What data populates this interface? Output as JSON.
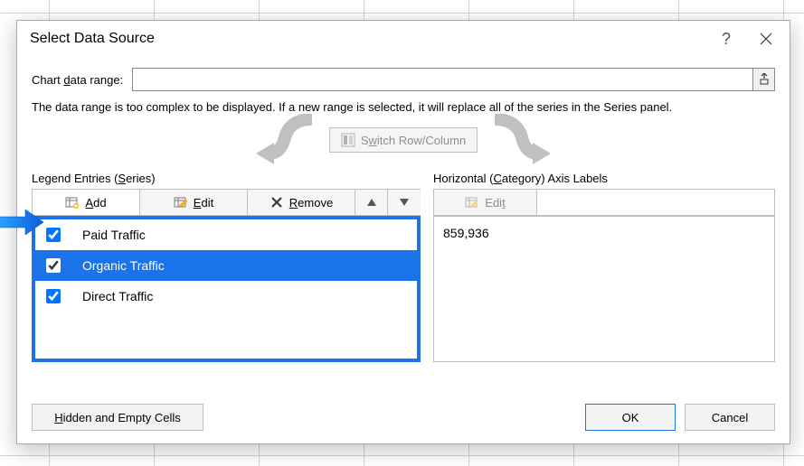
{
  "dialog": {
    "title": "Select Data Source",
    "help_label": "?",
    "close_label": "✕"
  },
  "range": {
    "label_pre": "Chart ",
    "label_ul": "d",
    "label_post": "ata range:"
  },
  "warning": "The data range is too complex to be displayed. If a new range is selected, it will replace all of the series in the Series panel.",
  "switch": {
    "label_pre": "S",
    "label_ul": "w",
    "label_post": "itch Row/Column"
  },
  "legend": {
    "section_pre": "Legend Entries (",
    "section_ul": "S",
    "section_post": "eries)",
    "add": {
      "ul": "A",
      "post": "dd"
    },
    "edit": {
      "ul": "E",
      "post": "dit"
    },
    "remove": {
      "ul": "R",
      "post": "emove"
    },
    "items": [
      {
        "label": "Paid Traffic",
        "checked": true,
        "selected": false
      },
      {
        "label": "Organic Traffic",
        "checked": true,
        "selected": true
      },
      {
        "label": "Direct Traffic",
        "checked": true,
        "selected": false
      }
    ]
  },
  "axis": {
    "section_pre": "Horizontal (",
    "section_ul": "C",
    "section_post": "ategory) Axis Labels",
    "edit": {
      "pre": "Edi",
      "ul": "t"
    },
    "values": [
      "859,936"
    ]
  },
  "footer": {
    "hidden": {
      "ul": "H",
      "post": "idden and Empty Cells"
    },
    "ok": "OK",
    "cancel": "Cancel"
  }
}
